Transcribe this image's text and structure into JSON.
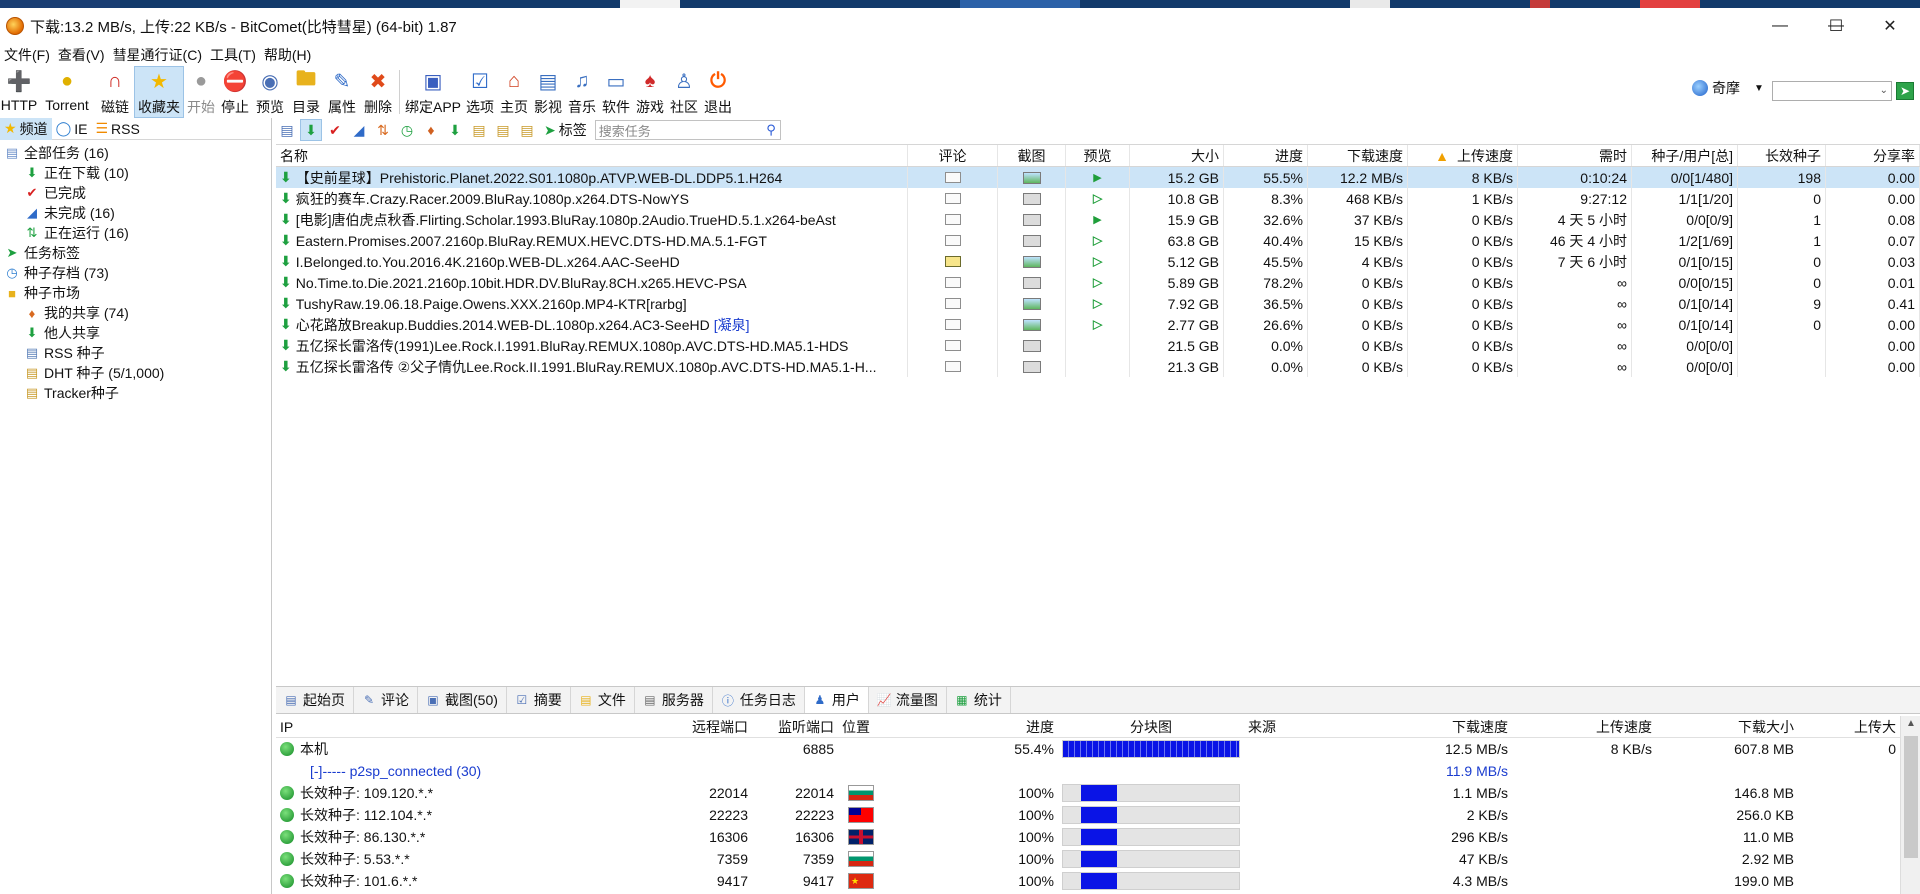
{
  "window": {
    "title": "下载:13.2 MB/s, 上传:22 KB/s - BitComet(比特彗星) (64-bit) 1.87"
  },
  "menu": [
    "文件(F)",
    "查看(V)",
    "彗星通行证(C)",
    "工具(T)",
    "帮助(H)"
  ],
  "toolbar": [
    {
      "label": "HTTP",
      "icon": "http-icon"
    },
    {
      "label": "Torrent",
      "icon": "torrent-icon"
    },
    {
      "label": "磁链",
      "icon": "magnet-icon"
    },
    {
      "label": "收藏夹",
      "icon": "star-icon"
    },
    {
      "label": "开始",
      "icon": "start-icon"
    },
    {
      "label": "停止",
      "icon": "stop-icon"
    },
    {
      "label": "预览",
      "icon": "preview-icon"
    },
    {
      "label": "目录",
      "icon": "folder-icon"
    },
    {
      "label": "属性",
      "icon": "properties-icon"
    },
    {
      "label": "删除",
      "icon": "delete-icon"
    },
    {
      "label": "绑定APP",
      "icon": "bind-app-icon"
    },
    {
      "label": "选项",
      "icon": "options-icon"
    },
    {
      "label": "主页",
      "icon": "home-icon"
    },
    {
      "label": "影视",
      "icon": "video-icon"
    },
    {
      "label": "音乐",
      "icon": "music-icon"
    },
    {
      "label": "软件",
      "icon": "software-icon"
    },
    {
      "label": "游戏",
      "icon": "game-icon"
    },
    {
      "label": "社区",
      "icon": "community-icon"
    },
    {
      "label": "退出",
      "icon": "exit-icon"
    }
  ],
  "qimo": {
    "label": "奇摩"
  },
  "left": {
    "tabs": [
      "频道",
      "IE",
      "RSS"
    ],
    "tree": [
      {
        "label": "全部任务 (16)",
        "level": 0
      },
      {
        "label": "正在下载 (10)",
        "level": 1
      },
      {
        "label": "已完成",
        "level": 1
      },
      {
        "label": "未完成 (16)",
        "level": 1
      },
      {
        "label": "正在运行 (16)",
        "level": 1
      },
      {
        "label": "任务标签",
        "level": 0
      },
      {
        "label": "种子存档 (73)",
        "level": 0
      },
      {
        "label": "种子市场",
        "level": 0
      },
      {
        "label": "我的共享 (74)",
        "level": 1
      },
      {
        "label": "他人共享",
        "level": 1
      },
      {
        "label": "RSS 种子",
        "level": 1
      },
      {
        "label": "DHT 种子 (5/1,000)",
        "level": 1
      },
      {
        "label": "Tracker种子",
        "level": 1
      }
    ]
  },
  "subtoolbar": {
    "tag_label": "标签",
    "search_placeholder": "搜索任务"
  },
  "tasks": {
    "columns": [
      "名称",
      "评论",
      "截图",
      "预览",
      "大小",
      "进度",
      "下载速度",
      "上传速度",
      "需时",
      "种子/用户[总]",
      "长效种子",
      "分享率"
    ],
    "rows": [
      {
        "name": "【史前星球】Prehistoric.Planet.2022.S01.1080p.ATVP.WEB-DL.DDP5.1.H264",
        "size": "15.2 GB",
        "progress": "55.5%",
        "down": "12.2 MB/s",
        "up": "8 KB/s",
        "eta": "0:10:24",
        "peers": "0/0[1/480]",
        "seeds": "198",
        "ratio": "0.00"
      },
      {
        "name": "疯狂的赛车.Crazy.Racer.2009.BluRay.1080p.x264.DTS-NowYS",
        "size": "10.8 GB",
        "progress": "8.3%",
        "down": "468 KB/s",
        "up": "1 KB/s",
        "eta": "9:27:12",
        "peers": "1/1[1/20]",
        "seeds": "0",
        "ratio": "0.00"
      },
      {
        "name": "[电影]唐伯虎点秋香.Flirting.Scholar.1993.BluRay.1080p.2Audio.TrueHD.5.1.x264-beAst",
        "size": "15.9 GB",
        "progress": "32.6%",
        "down": "37 KB/s",
        "up": "0 KB/s",
        "eta": "4 天 5 小时",
        "peers": "0/0[0/9]",
        "seeds": "1",
        "ratio": "0.08"
      },
      {
        "name": "Eastern.Promises.2007.2160p.BluRay.REMUX.HEVC.DTS-HD.MA.5.1-FGT",
        "size": "63.8 GB",
        "progress": "40.4%",
        "down": "15 KB/s",
        "up": "0 KB/s",
        "eta": "46 天 4 小时",
        "peers": "1/2[1/69]",
        "seeds": "1",
        "ratio": "0.07"
      },
      {
        "name": "I.Belonged.to.You.2016.4K.2160p.WEB-DL.x264.AAC-SeeHD",
        "size": "5.12 GB",
        "progress": "45.5%",
        "down": "4 KB/s",
        "up": "0 KB/s",
        "eta": "7 天 6 小时",
        "peers": "0/1[0/15]",
        "seeds": "0",
        "ratio": "0.03"
      },
      {
        "name": "No.Time.to.Die.2021.2160p.10bit.HDR.DV.BluRay.8CH.x265.HEVC-PSA",
        "size": "5.89 GB",
        "progress": "78.2%",
        "down": "0 KB/s",
        "up": "0 KB/s",
        "eta": "∞",
        "peers": "0/0[0/15]",
        "seeds": "0",
        "ratio": "0.01"
      },
      {
        "name": "TushyRaw.19.06.18.Paige.Owens.XXX.2160p.MP4-KTR[rarbg]",
        "size": "7.92 GB",
        "progress": "36.5%",
        "down": "0 KB/s",
        "up": "0 KB/s",
        "eta": "∞",
        "peers": "0/1[0/14]",
        "seeds": "9",
        "ratio": "0.41"
      },
      {
        "name": "心花路放Breakup.Buddies.2014.WEB-DL.1080p.x264.AC3-SeeHD",
        "extra": "[凝泉]",
        "size": "2.77 GB",
        "progress": "26.6%",
        "down": "0 KB/s",
        "up": "0 KB/s",
        "eta": "∞",
        "peers": "0/1[0/14]",
        "seeds": "0",
        "ratio": "0.00"
      },
      {
        "name": "五亿探长雷洛传(1991)Lee.Rock.I.1991.BluRay.REMUX.1080p.AVC.DTS-HD.MA5.1-HDS",
        "size": "21.5 GB",
        "progress": "0.0%",
        "down": "0 KB/s",
        "up": "0 KB/s",
        "eta": "∞",
        "peers": "0/0[0/0]",
        "seeds": "",
        "ratio": "0.00"
      },
      {
        "name": "五亿探长雷洛传 ②父子情仇Lee.Rock.II.1991.BluRay.REMUX.1080p.AVC.DTS-HD.MA5.1-H...",
        "size": "21.3 GB",
        "progress": "0.0%",
        "down": "0 KB/s",
        "up": "0 KB/s",
        "eta": "∞",
        "peers": "0/0[0/0]",
        "seeds": "",
        "ratio": "0.00"
      }
    ]
  },
  "bottom_tabs": [
    "起始页",
    "评论",
    "截图(50)",
    "摘要",
    "文件",
    "服务器",
    "任务日志",
    "用户",
    "流量图",
    "统计"
  ],
  "peers": {
    "columns": [
      "IP",
      "远程端口",
      "监听端口",
      "位置",
      "进度",
      "分块图",
      "来源",
      "下载速度",
      "上传速度",
      "下载大小",
      "上传大"
    ],
    "local": {
      "ip": "本机",
      "listen": "6885",
      "progress": "55.4%",
      "down": "12.5 MB/s",
      "up": "8 KB/s",
      "size": "607.8 MB",
      "upsize": "0"
    },
    "group": {
      "label": "[-]----- p2sp_connected (30)",
      "down": "11.9 MB/s"
    },
    "rows": [
      {
        "ip": "长效种子: 109.120.*.*",
        "remote": "22014",
        "listen": "22014",
        "flag": "bg",
        "progress": "100%",
        "down": "1.1 MB/s",
        "up": "",
        "size": "146.8 MB"
      },
      {
        "ip": "长效种子: 112.104.*.*",
        "remote": "22223",
        "listen": "22223",
        "flag": "tw",
        "progress": "100%",
        "down": "2 KB/s",
        "up": "",
        "size": "256.0 KB"
      },
      {
        "ip": "长效种子: 86.130.*.*",
        "remote": "16306",
        "listen": "16306",
        "flag": "gb",
        "progress": "100%",
        "down": "296 KB/s",
        "up": "",
        "size": "11.0 MB"
      },
      {
        "ip": "长效种子: 5.53.*.*",
        "remote": "7359",
        "listen": "7359",
        "flag": "bg",
        "progress": "100%",
        "down": "47 KB/s",
        "up": "",
        "size": "2.92 MB"
      },
      {
        "ip": "长效种子: 101.6.*.*",
        "remote": "9417",
        "listen": "9417",
        "flag": "cn",
        "progress": "100%",
        "down": "4.3 MB/s",
        "up": "",
        "size": "199.0 MB"
      }
    ]
  },
  "colors": {
    "selection": "#cce4f7",
    "accent_green": "#1ea040",
    "bar_blue": "#0a14e6"
  }
}
